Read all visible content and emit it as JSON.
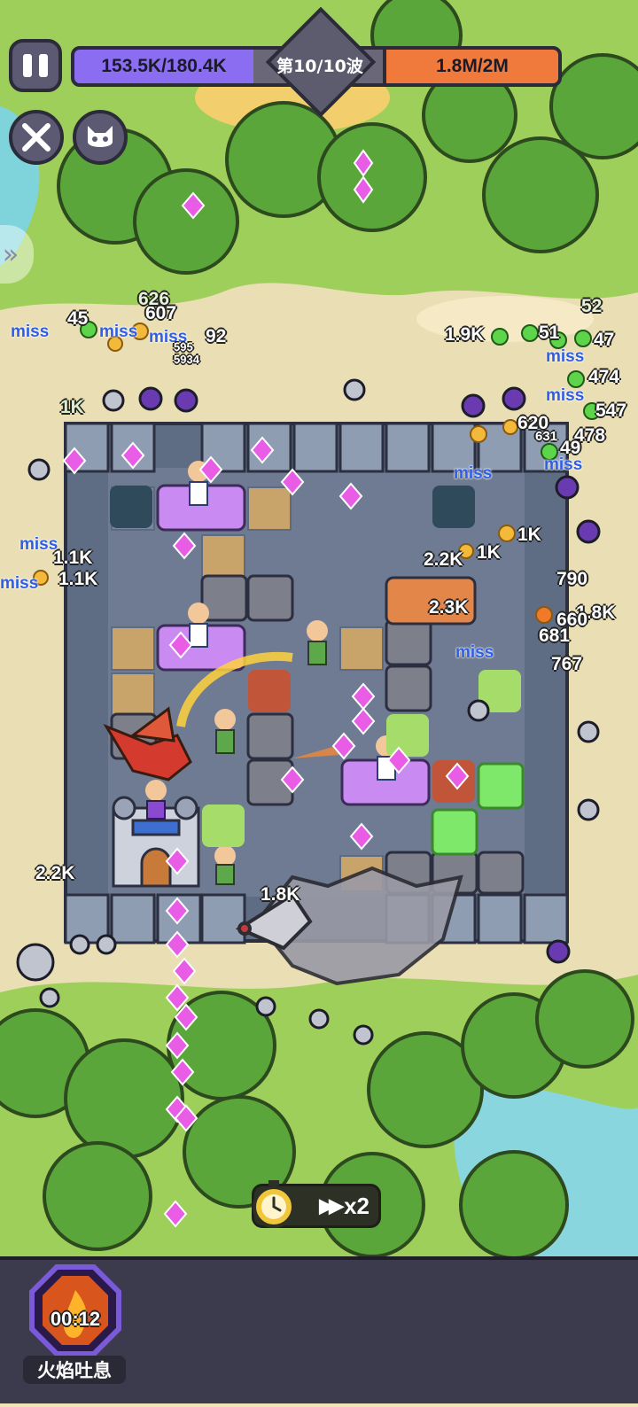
{
  "hud": {
    "player_hp": "153.5K/180.4K",
    "wave": "第10/10波",
    "boss_hp": "1.8M/2M",
    "pause_icon": "pause-icon",
    "skill_button_1_icon": "crossed-swords-icon",
    "skill_button_2_icon": "demon-face-icon",
    "side_arrow_icon": "double-chevron-right-icon"
  },
  "speed": {
    "icon": "stopwatch-icon",
    "arrows": "▶▶",
    "multiplier": "x2"
  },
  "skill": {
    "timer": "00:12",
    "name": "火焰吐息",
    "icon": "flame-breath-icon"
  },
  "floating_text": [
    "miss",
    "miss",
    "miss",
    "miss",
    "miss",
    "miss",
    "miss",
    "miss",
    "miss",
    "miss",
    "1.9K",
    "2.2K",
    "2.3K",
    "1.1K",
    "1.1K",
    "1K",
    "1K",
    "790",
    "1.8K",
    "660",
    "681",
    "767",
    "2.2K",
    "1.8K",
    "474",
    "547",
    "478",
    "49",
    "51",
    "47",
    "52",
    "607",
    "626",
    "92",
    "45",
    "595",
    "5934",
    "620",
    "631",
    "1K"
  ],
  "colors": {
    "player_bar": "#8b6df2",
    "boss_bar": "#f07a3c",
    "miss_text": "#2e5ee6",
    "crystal": "#e85ce6"
  }
}
